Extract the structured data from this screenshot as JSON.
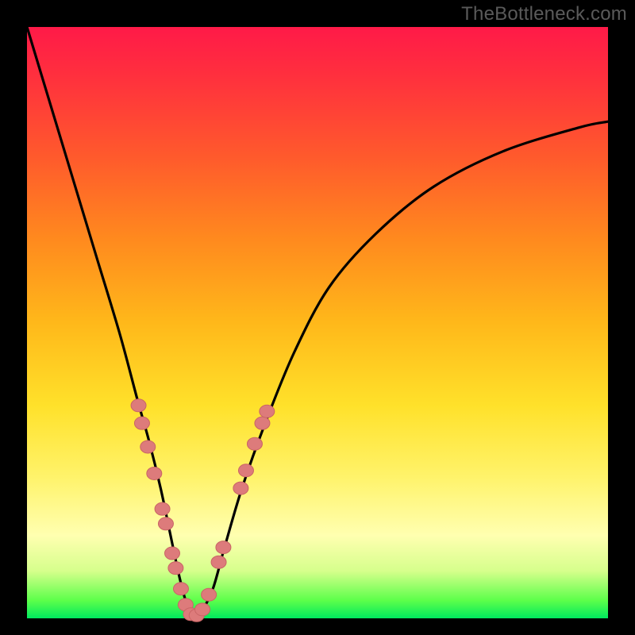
{
  "watermark": "TheBottleneck.com",
  "chart_data": {
    "type": "line",
    "title": "",
    "xlabel": "",
    "ylabel": "",
    "xlim": [
      0,
      100
    ],
    "ylim": [
      0,
      100
    ],
    "grid": false,
    "legend": false,
    "series": [
      {
        "name": "bottleneck-curve",
        "x": [
          0,
          4,
          8,
          12,
          16,
          19,
          21,
          23,
          24.5,
          26,
          27,
          28,
          29,
          30,
          32,
          34,
          37,
          41,
          46,
          52,
          60,
          70,
          82,
          95,
          100
        ],
        "y": [
          100,
          87,
          74,
          61,
          48,
          37,
          30,
          22,
          15,
          8,
          4,
          1,
          0,
          1,
          5,
          12,
          22,
          33,
          45,
          56,
          65,
          73,
          79,
          83,
          84
        ]
      }
    ],
    "markers": {
      "name": "highlighted-points",
      "color": "#e57373",
      "points": [
        {
          "x": 19.2,
          "y": 36.0
        },
        {
          "x": 19.8,
          "y": 33.0
        },
        {
          "x": 20.8,
          "y": 29.0
        },
        {
          "x": 21.9,
          "y": 24.5
        },
        {
          "x": 23.3,
          "y": 18.5
        },
        {
          "x": 23.9,
          "y": 16.0
        },
        {
          "x": 25.0,
          "y": 11.0
        },
        {
          "x": 25.6,
          "y": 8.5
        },
        {
          "x": 26.5,
          "y": 5.0
        },
        {
          "x": 27.3,
          "y": 2.3
        },
        {
          "x": 28.2,
          "y": 0.7
        },
        {
          "x": 29.2,
          "y": 0.5
        },
        {
          "x": 30.2,
          "y": 1.5
        },
        {
          "x": 31.3,
          "y": 4.0
        },
        {
          "x": 33.0,
          "y": 9.5
        },
        {
          "x": 33.8,
          "y": 12.0
        },
        {
          "x": 36.8,
          "y": 22.0
        },
        {
          "x": 37.7,
          "y": 25.0
        },
        {
          "x": 39.2,
          "y": 29.5
        },
        {
          "x": 40.5,
          "y": 33.0
        },
        {
          "x": 41.3,
          "y": 35.0
        }
      ]
    }
  },
  "colors": {
    "curve_stroke": "#000000",
    "marker_fill": "#dd7b7b",
    "marker_stroke": "#c96565"
  }
}
